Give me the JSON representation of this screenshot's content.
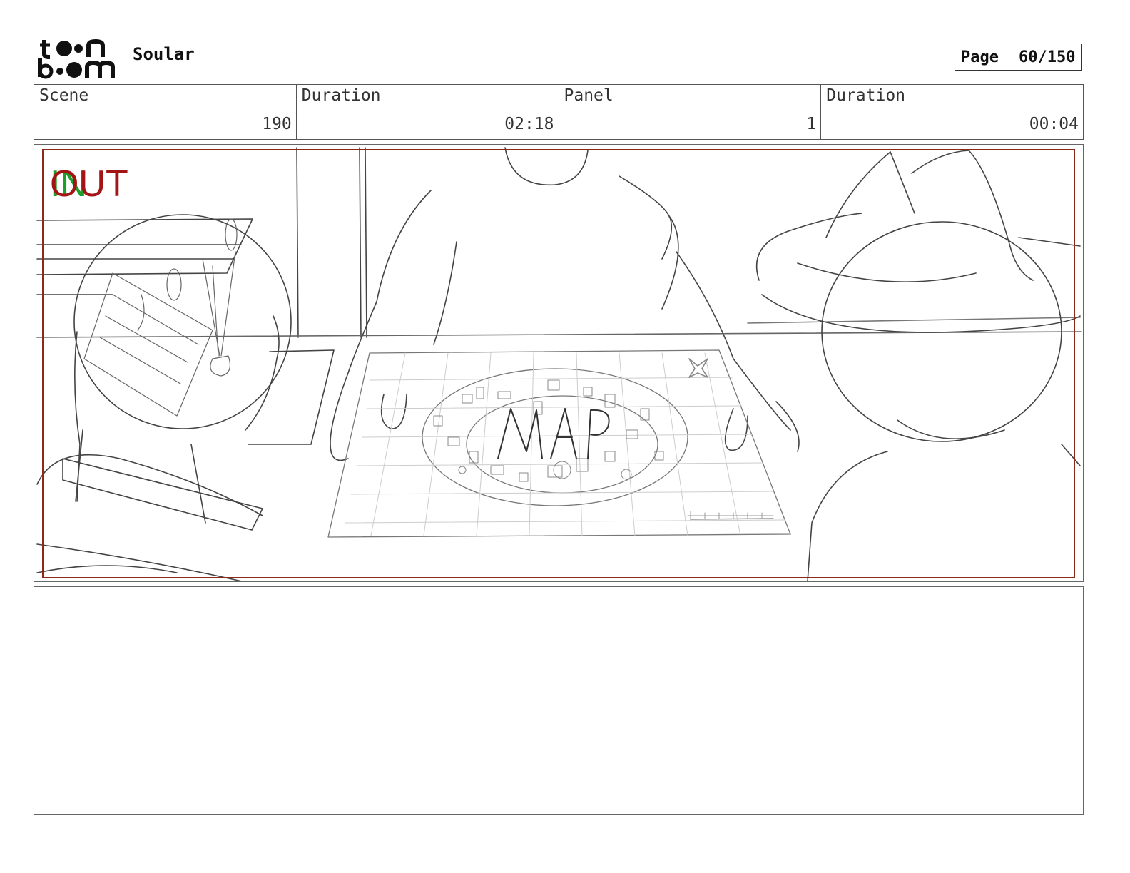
{
  "header": {
    "project_title": "Soular",
    "page_label": "Page",
    "page_value": "60/150",
    "logo_text_top": "toon",
    "logo_text_bottom": "boom"
  },
  "info": {
    "scene_label": "Scene",
    "scene_value": "190",
    "scene_duration_label": "Duration",
    "scene_duration_value": "02:18",
    "panel_label": "Panel",
    "panel_value": "1",
    "panel_duration_label": "Duration",
    "panel_duration_value": "00:04"
  },
  "panel": {
    "in_marker": "IN",
    "out_marker": "OUT",
    "map_text": "MAP",
    "in_color": "#1e9e2a",
    "out_color": "#a31515",
    "frame_color": "#8b2a1a"
  },
  "notes": {
    "text": ""
  }
}
